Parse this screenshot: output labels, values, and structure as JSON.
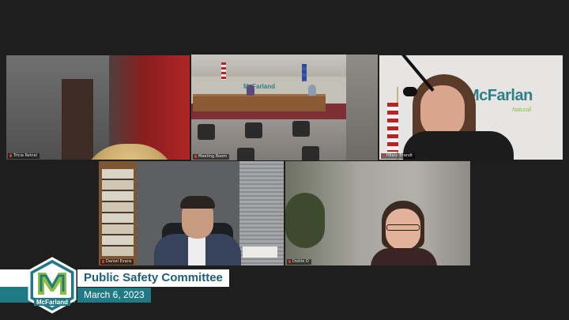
{
  "participants": [
    {
      "id": "tricia",
      "name": "Tricia Reinel"
    },
    {
      "id": "room",
      "name": "Meeting Room"
    },
    {
      "id": "hilary",
      "name": "Hilary Brandt"
    },
    {
      "id": "daniel",
      "name": "Daniel Evans"
    },
    {
      "id": "dottie",
      "name": "Dottie O"
    }
  ],
  "active_speaker": "room",
  "room": {
    "wall_logo": "McFarland"
  },
  "hilary_tile": {
    "sign_text": "McFarlan",
    "sign_subtext": "Naturall"
  },
  "banner": {
    "logo_text": "McFarland",
    "title": "Public Safety Committee",
    "date": "March 6, 2023"
  },
  "colors": {
    "accent_teal": "#1f7a86",
    "title_text": "#1f5f7a",
    "active_border": "#c8d24a",
    "logo_green": "#8cbf3f",
    "background": "#1e1e1e"
  }
}
